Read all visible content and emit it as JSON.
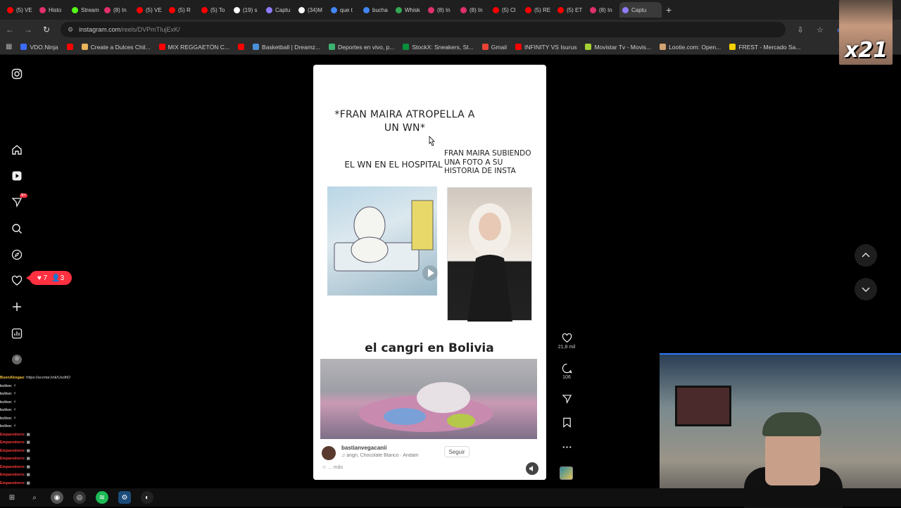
{
  "browser": {
    "tabs": [
      {
        "label": "(5) VE",
        "color": "#ff0000"
      },
      {
        "label": "Histo",
        "color": "#e1306c"
      },
      {
        "label": "Stream",
        "color": "#53fc18"
      },
      {
        "label": "(8) In",
        "color": "#e1306c"
      },
      {
        "label": "(5) VE",
        "color": "#ff0000"
      },
      {
        "label": "(5) R",
        "color": "#ff0000"
      },
      {
        "label": "(5) To",
        "color": "#ff0000"
      },
      {
        "label": "(19) s",
        "color": "#ffffff"
      },
      {
        "label": "Captu",
        "color": "#8e7cff"
      },
      {
        "label": "(34)M",
        "color": "#ffffff"
      },
      {
        "label": "que t",
        "color": "#4285f4"
      },
      {
        "label": "bucha",
        "color": "#4285f4"
      },
      {
        "label": "Whisk",
        "color": "#34a853"
      },
      {
        "label": "(8) In",
        "color": "#e1306c"
      },
      {
        "label": "(8) In",
        "color": "#e1306c"
      },
      {
        "label": "(5) Cl",
        "color": "#ff0000"
      },
      {
        "label": "(5) RE",
        "color": "#ff0000"
      },
      {
        "label": "(5) ET",
        "color": "#ff0000"
      },
      {
        "label": "(8) In",
        "color": "#e1306c"
      },
      {
        "label": "Captu",
        "color": "#8e7cff"
      }
    ],
    "new_tab": "+",
    "url_host": "instagram.com",
    "url_path": "/reels/DVPmTIujExK/",
    "bookmarks": [
      {
        "label": "VDO.Ninja",
        "color": "#3b6bff"
      },
      {
        "label": "",
        "color": "#ff0000"
      },
      {
        "label": "Create a Dulces Chil...",
        "color": "#e8b35a"
      },
      {
        "label": "MIX REGGAETÓN C...",
        "color": "#ff0000"
      },
      {
        "label": "",
        "color": "#ff0000"
      },
      {
        "label": "Basketball | Dreamz...",
        "color": "#4a90d9"
      },
      {
        "label": "Deportes en vivo, p...",
        "color": "#3cb371"
      },
      {
        "label": "StockX: Sneakers, St...",
        "color": "#0a8f3c"
      },
      {
        "label": "Gmail",
        "color": "#ea4335"
      },
      {
        "label": "INFINITY VS Isurus",
        "color": "#ff0000"
      },
      {
        "label": "Movistar Tv - Movis...",
        "color": "#a4d233"
      },
      {
        "label": "Lootie.com: Open...",
        "color": "#d4a373"
      },
      {
        "label": "FREST - Mercado Sa...",
        "color": "#f5d000"
      }
    ]
  },
  "instagram": {
    "notifications": {
      "likes": "7",
      "follows": "3"
    },
    "reel": {
      "top_text": "*FRAN MAIRA ATROPELLA A UN WN*",
      "left_caption": "EL WN EN EL HOSPITAL",
      "right_caption": "FRAN MAIRA SUBIENDO UNA FOTO A SU HISTORIA DE INSTA",
      "bottom_text": "el cangri en Bolivia",
      "username": "bastianvegacanii",
      "music": "angri, Chocolate Blanco · Andam",
      "follow_label": "Seguir",
      "caption_more": "... más"
    },
    "actions": {
      "likes": "21,8 mil",
      "comments": "106"
    }
  },
  "stream": {
    "webcam_label": "x21",
    "chat": [
      {
        "user": "BuenAbogao",
        "msg": ": https://acortar.link/UsolhD",
        "color": "#f5c242"
      },
      {
        "user": "kvlinn",
        "msg": ": ⚡",
        "color": "#cccccc"
      },
      {
        "user": "kvlinn",
        "msg": ": ⚡",
        "color": "#cccccc"
      },
      {
        "user": "kvlinn",
        "msg": ": ⚡",
        "color": "#cccccc"
      },
      {
        "user": "kvlinn",
        "msg": ": ⚡",
        "color": "#cccccc"
      },
      {
        "user": "kvlinn",
        "msg": ": ⚡",
        "color": "#cccccc"
      },
      {
        "user": "kvlinn",
        "msg": ": ⚡",
        "color": "#cccccc"
      },
      {
        "user": "Emparedorro",
        "msg": ": ▦",
        "color": "#ff3b3b"
      },
      {
        "user": "Emparedorro",
        "msg": ": ▦",
        "color": "#ff3b3b"
      },
      {
        "user": "Emparedorro",
        "msg": ": ▦",
        "color": "#ff3b3b"
      },
      {
        "user": "Emparedorro",
        "msg": ": ▦",
        "color": "#ff3b3b"
      },
      {
        "user": "Emparedorro",
        "msg": ": ▦",
        "color": "#ff3b3b"
      },
      {
        "user": "Emparedorro",
        "msg": ": ▦",
        "color": "#ff3b3b"
      },
      {
        "user": "Emparedorro",
        "msg": ": ▦",
        "color": "#ff3b3b"
      },
      {
        "user": "Emparedorro",
        "msg": ": ▦",
        "color": "#ff3b3b"
      }
    ]
  }
}
